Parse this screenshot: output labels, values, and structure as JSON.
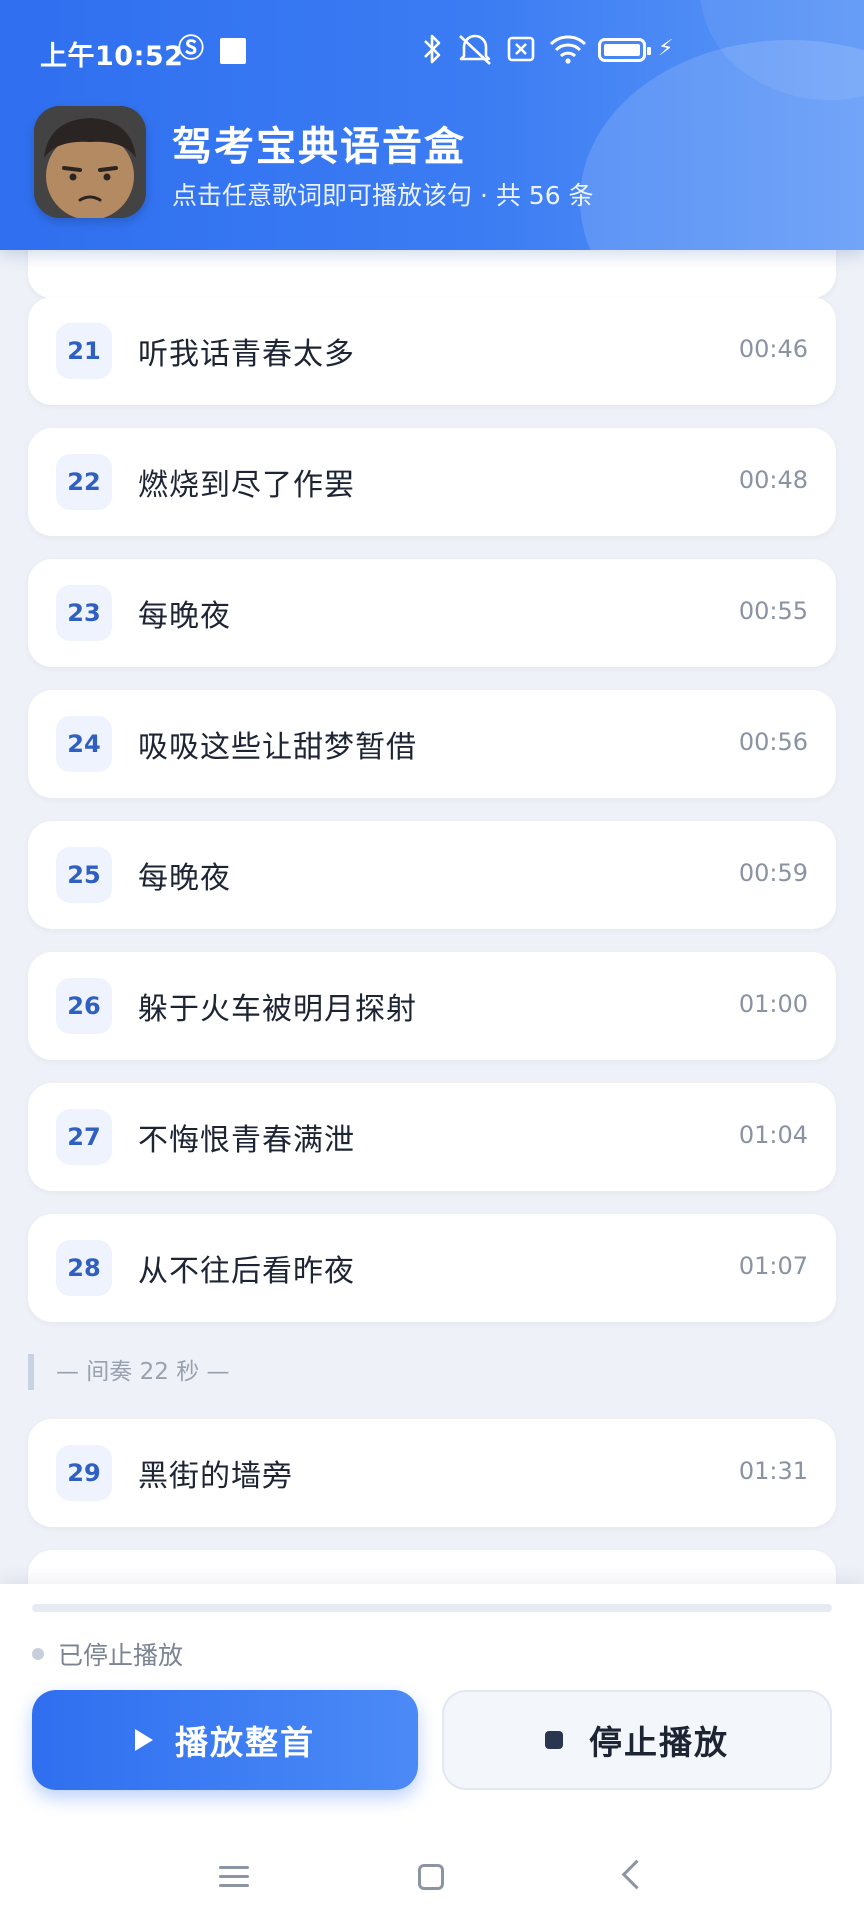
{
  "status_bar": {
    "time": "上午10:52",
    "icons": [
      "sim-icon",
      "stop-square-icon",
      "bluetooth-icon",
      "mute-icon",
      "no-sim-icon",
      "wifi-icon",
      "battery-icon",
      "charging-icon"
    ]
  },
  "header": {
    "title": "驾考宝典语音盒",
    "subtitle": "点击任意歌词即可播放该句 · 共 56 条"
  },
  "lyrics": [
    {
      "num": "21",
      "text": "听我话青春太多",
      "time": "00:46"
    },
    {
      "num": "22",
      "text": "燃烧到尽了作罢",
      "time": "00:48"
    },
    {
      "num": "23",
      "text": "每晚夜",
      "time": "00:55"
    },
    {
      "num": "24",
      "text": "吸吸这些让甜梦暂借",
      "time": "00:56"
    },
    {
      "num": "25",
      "text": "每晚夜",
      "time": "00:59"
    },
    {
      "num": "26",
      "text": "躲于火车被明月探射",
      "time": "01:00"
    },
    {
      "num": "27",
      "text": "不悔恨青春满泄",
      "time": "01:04"
    },
    {
      "num": "28",
      "text": "从不往后看昨夜",
      "time": "01:07"
    }
  ],
  "interlude": "— 间奏 22 秒 —",
  "lyrics_after": [
    {
      "num": "29",
      "text": "黑街的墙旁",
      "time": "01:31"
    }
  ],
  "player": {
    "progress": 0,
    "state": "已停止播放",
    "play_label": "播放整首",
    "stop_label": "停止播放"
  },
  "colors": {
    "accent": "#2f6ff0",
    "number_text": "#2f5fc0",
    "background": "#eef1f7"
  }
}
